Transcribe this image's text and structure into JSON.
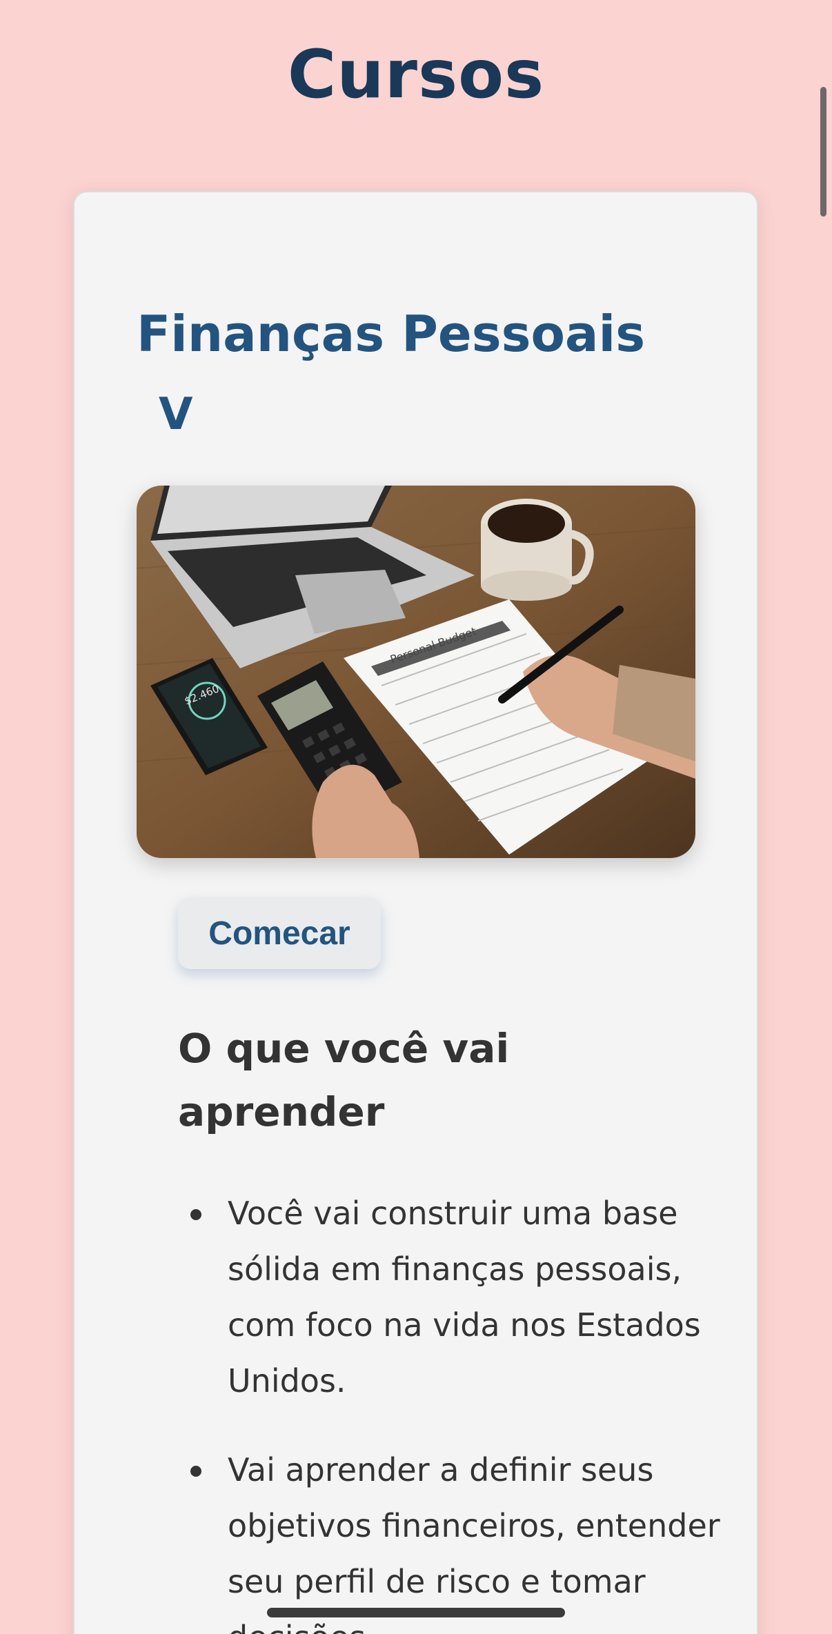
{
  "header": {
    "title": "Cursos"
  },
  "course": {
    "title": "Finanças Pessoais",
    "toggle_label": "V",
    "image_alt": "Personal Budget",
    "image_texts": {
      "phone_balance": "$2.460",
      "sheet_title": "Personal Budget"
    },
    "start_label": "Comecar",
    "learn_heading": "O que você vai aprender",
    "learn_items": [
      "Você vai construir uma base sólida em finanças pessoais, com foco na vida nos Estados Unidos.",
      "Vai aprender a definir seus objetivos financeiros, entender seu perfil de risco e tomar decisões"
    ]
  },
  "colors": {
    "background": "#fbd3d1",
    "title": "#1a3857",
    "accent": "#23547f",
    "card": "#f4f4f4",
    "text": "#333333"
  }
}
